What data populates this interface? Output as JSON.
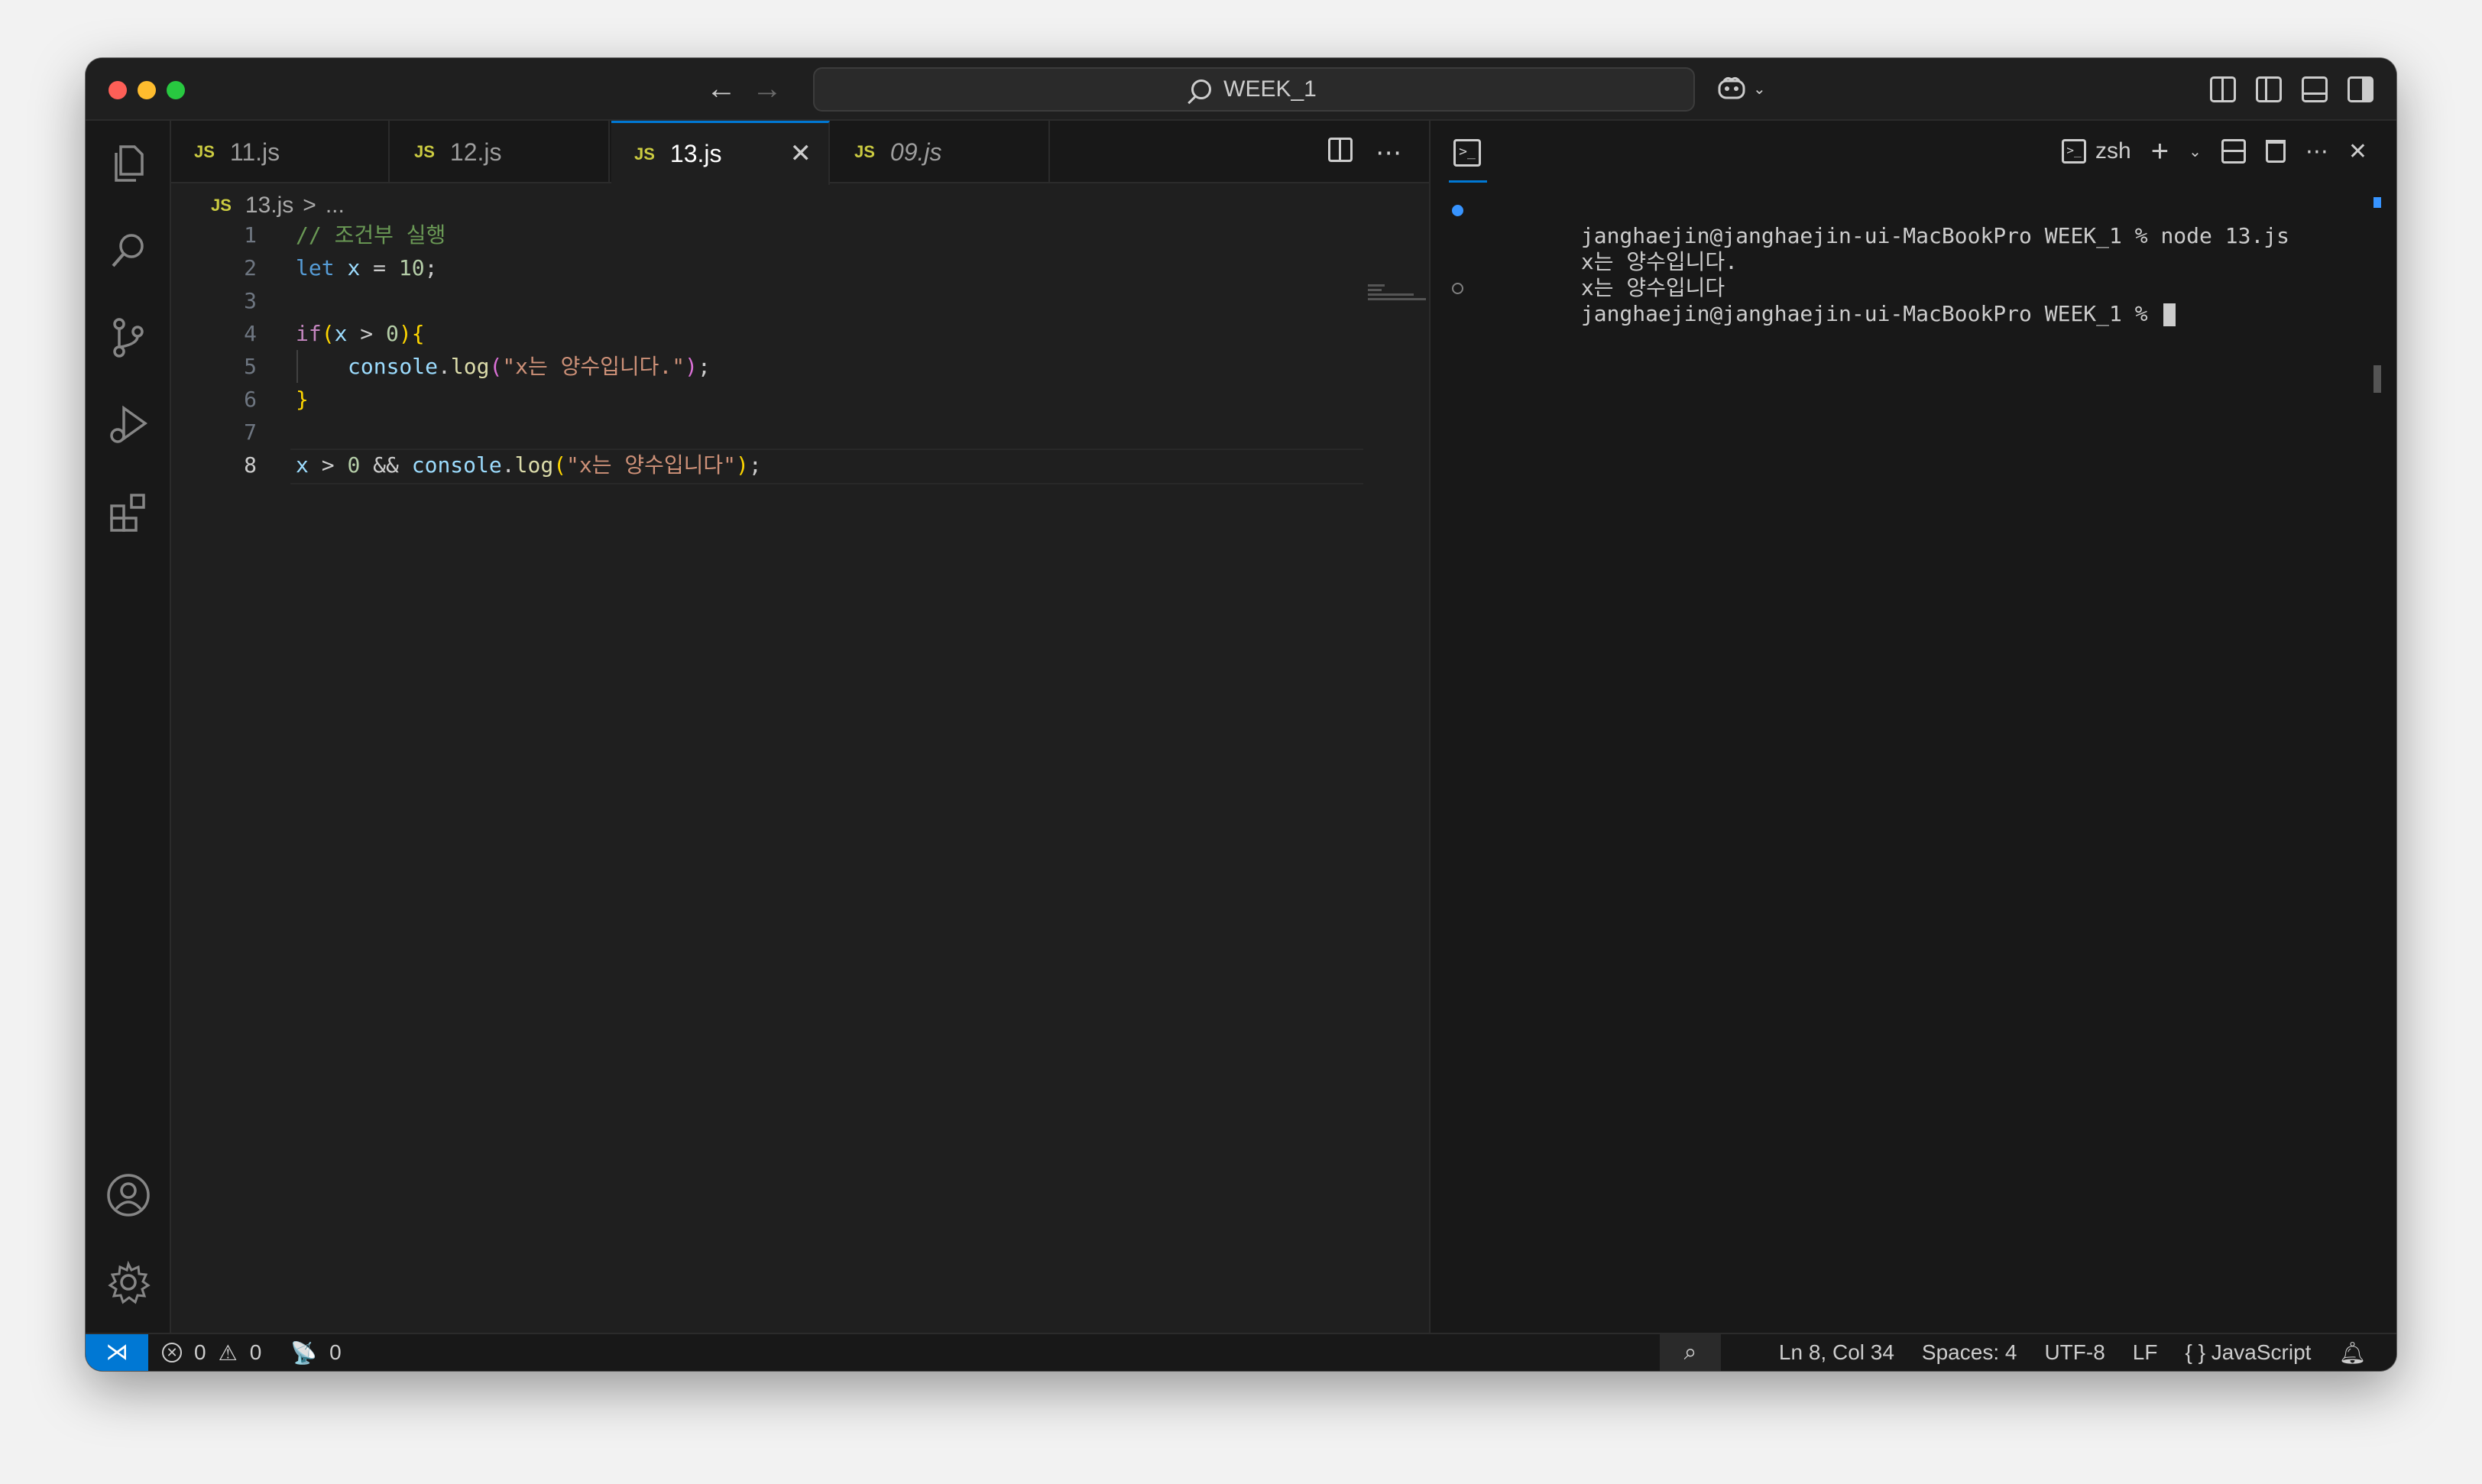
{
  "titlebar": {
    "search_label": "WEEK_1",
    "back_glyph": "←",
    "forward_glyph": "→"
  },
  "tabs": [
    {
      "label": "11.js",
      "icon": "JS"
    },
    {
      "label": "12.js",
      "icon": "JS"
    },
    {
      "label": "13.js",
      "icon": "JS",
      "active": true
    },
    {
      "label": "09.js",
      "icon": "JS",
      "italic": true
    }
  ],
  "breadcrumb": {
    "icon": "JS",
    "file": "13.js",
    "separator": ">",
    "rest": "..."
  },
  "editor": {
    "line_numbers": [
      "1",
      "2",
      "3",
      "4",
      "5",
      "6",
      "7",
      "8"
    ],
    "lines": {
      "l1_comment": "// 조건부 실행",
      "l2_kw": "let",
      "l2_var": "x",
      "l2_op": " = ",
      "l2_num": "10",
      "l2_end": ";",
      "l4_kw": "if",
      "l4_open": "(",
      "l4_var": "x",
      "l4_op": " > ",
      "l4_num": "0",
      "l4_close": ")",
      "l4_brace": "{",
      "l5_obj": "console",
      "l5_dot": ".",
      "l5_fn": "log",
      "l5_open": "(",
      "l5_str": "\"x는 양수입니다.\"",
      "l5_close": ")",
      "l5_end": ";",
      "l6_brace": "}",
      "l8_var": "x",
      "l8_op1": " > ",
      "l8_num": "0",
      "l8_op2": " && ",
      "l8_obj": "console",
      "l8_dot": ".",
      "l8_fn": "log",
      "l8_open": "(",
      "l8_str": "\"x는 양수입니다\"",
      "l8_close": ")",
      "l8_end": ";"
    }
  },
  "terminal": {
    "shell": "zsh",
    "prompt_1": "janghaejin@janghaejin-ui-MacBookPro WEEK_1 % node 13.js",
    "output_1": "x는 양수입니다.",
    "output_2": "x는 양수입니다",
    "prompt_2": "janghaejin@janghaejin-ui-MacBookPro WEEK_1 % "
  },
  "statusbar": {
    "errors": "0",
    "warnings": "0",
    "ports": "0",
    "cursor_pos": "Ln 8, Col 34",
    "spaces": "Spaces: 4",
    "encoding": "UTF-8",
    "eol": "LF",
    "language": "JavaScript",
    "language_icon": "{ }"
  },
  "colors": {
    "accent": "#0078d4",
    "js_icon": "#cbcb41",
    "terminal_dot": "#3794ff"
  },
  "icons": [
    "explorer-icon",
    "search-icon",
    "source-control-icon",
    "run-debug-icon",
    "extensions-icon",
    "account-icon",
    "gear-icon",
    "copilot-icon",
    "bell-icon",
    "zoom-icon",
    "remote-icon"
  ]
}
